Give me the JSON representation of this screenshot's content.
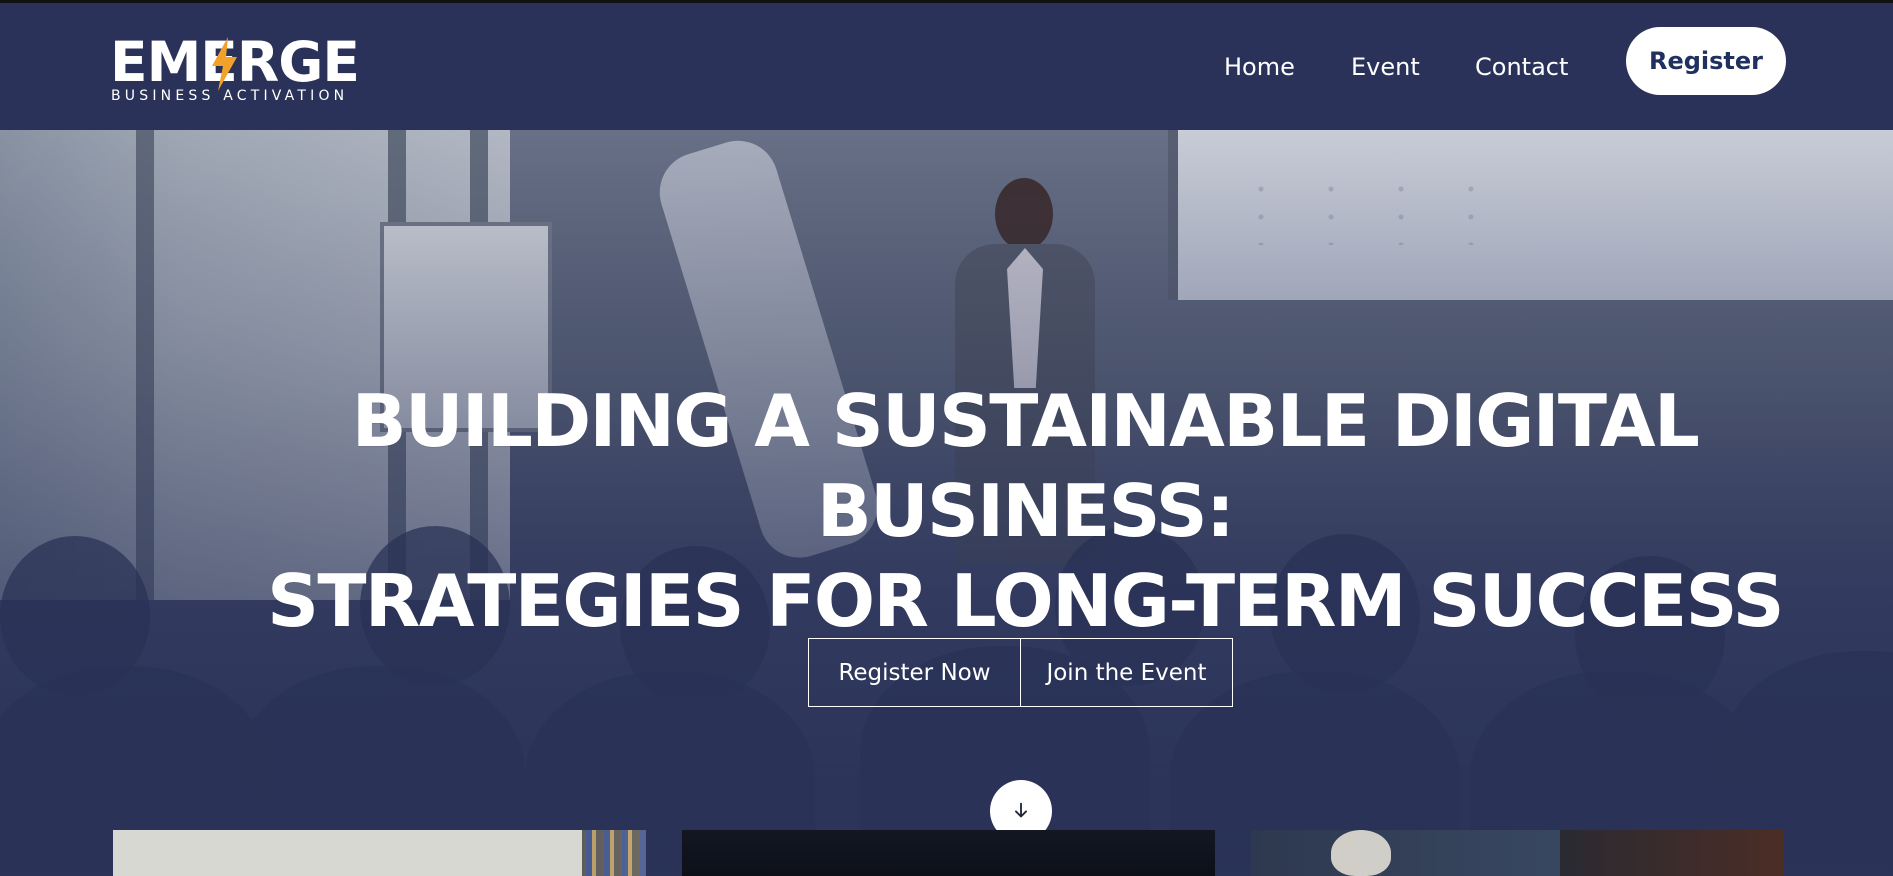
{
  "header": {
    "logo": {
      "word": "EMERGE",
      "subtitle": "BUSINESS ACTIVATION",
      "accent": "#f2a12b"
    },
    "nav": {
      "items": [
        {
          "label": "Home"
        },
        {
          "label": "Event"
        },
        {
          "label": "Contact"
        }
      ],
      "register_label": "Register"
    }
  },
  "hero": {
    "title_line1": "BUILDING A SUSTAINABLE DIGITAL BUSINESS:",
    "title_line2": "STRATEGIES FOR LONG-TERM SUCCESS",
    "primary_action": "Register Now",
    "secondary_action": "Join the Event",
    "scroll_icon": "arrow-down-icon"
  },
  "colors": {
    "header_bg": "#2a3259",
    "hero_overlay": "#2b3358",
    "button_text": "#20305f"
  }
}
